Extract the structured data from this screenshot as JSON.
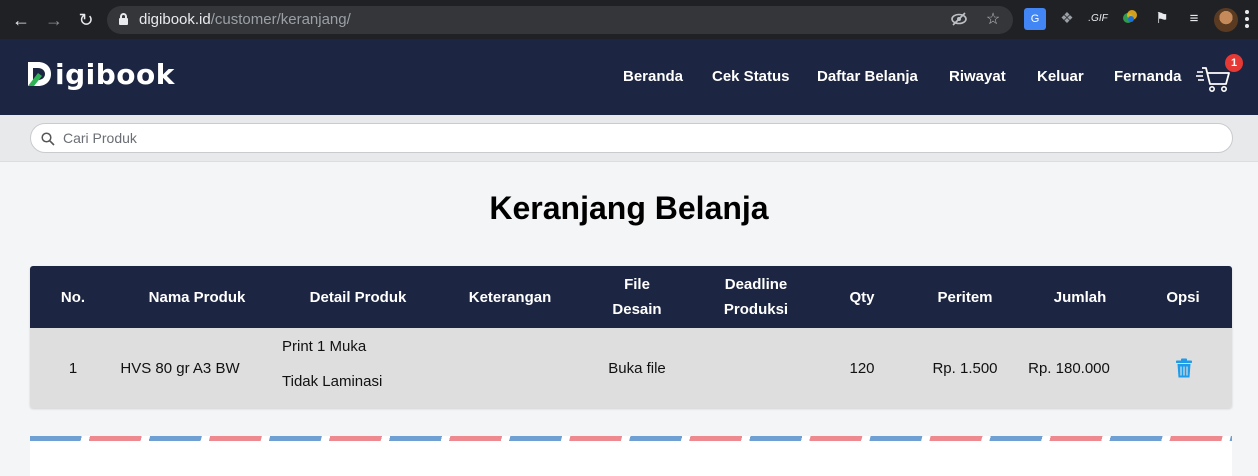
{
  "browser": {
    "url_host": "digibook.id",
    "url_path": "/customer/keranjang/"
  },
  "header": {
    "logo_text": "igibook",
    "nav": [
      "Beranda",
      "Cek Status",
      "Daftar Belanja",
      "Riwayat",
      "Keluar",
      "Fernanda"
    ],
    "cart_count": "1"
  },
  "search": {
    "placeholder": "Cari Produk"
  },
  "page": {
    "title": "Keranjang Belanja"
  },
  "table": {
    "headers": {
      "no": "No.",
      "nama": "Nama Produk",
      "detail": "Detail Produk",
      "keterangan": "Keterangan",
      "file_1": "File",
      "file_2": "Desain",
      "deadline_1": "Deadline",
      "deadline_2": "Produksi",
      "qty": "Qty",
      "peritem": "Peritem",
      "jumlah": "Jumlah",
      "opsi": "Opsi"
    },
    "rows": [
      {
        "no": "1",
        "nama": "HVS 80 gr A3 BW",
        "detail_1": "Print 1 Muka",
        "detail_2": "Tidak Laminasi",
        "keterangan": "",
        "file": "Buka file",
        "deadline": "",
        "qty": "120",
        "peritem": "Rp. 1.500",
        "jumlah": "Rp. 180.000"
      }
    ]
  },
  "colors": {
    "navy": "#1c2541",
    "badge": "#e53935",
    "trash": "#1e9be9"
  }
}
